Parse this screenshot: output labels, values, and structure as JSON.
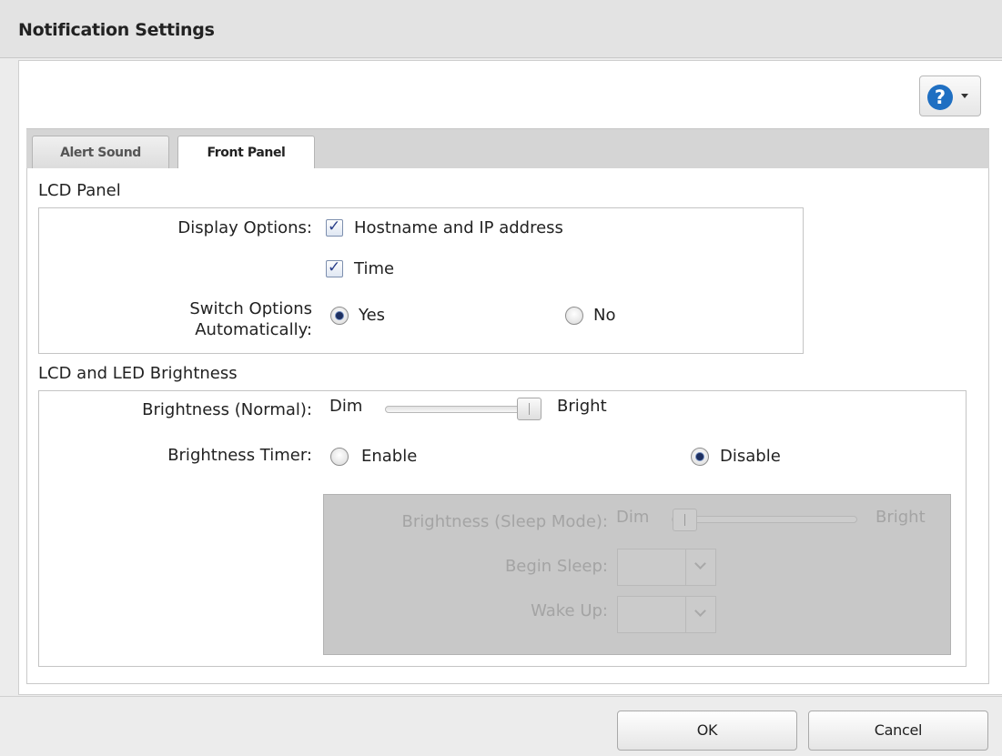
{
  "window": {
    "title": "Notification Settings"
  },
  "help": {
    "icon": "help-question-icon",
    "glyph": "?"
  },
  "tabs": [
    {
      "label": "Alert Sound",
      "active": false
    },
    {
      "label": "Front Panel",
      "active": true
    }
  ],
  "lcd_panel": {
    "title": "LCD Panel",
    "display_options_label": "Display Options:",
    "options": [
      {
        "label": "Hostname and IP address",
        "checked": true
      },
      {
        "label": "Time",
        "checked": true
      }
    ],
    "switch_label_line1": "Switch Options",
    "switch_label_line2": "Automatically:",
    "switch_yes": "Yes",
    "switch_no": "No",
    "switch_value": "Yes"
  },
  "brightness": {
    "title": "LCD and LED Brightness",
    "normal_label": "Brightness (Normal):",
    "dim": "Dim",
    "bright": "Bright",
    "normal_level": 1.0,
    "timer_label": "Brightness Timer:",
    "timer_enable": "Enable",
    "timer_disable": "Disable",
    "timer_value": "Disable",
    "sleep": {
      "label": "Brightness (Sleep Mode):",
      "dim": "Dim",
      "bright": "Bright",
      "level": 0.0,
      "begin_label": "Begin Sleep:",
      "begin_value": "",
      "wake_label": "Wake Up:",
      "wake_value": ""
    }
  },
  "footer": {
    "ok": "OK",
    "cancel": "Cancel"
  },
  "colors": {
    "help_blue": "#1f6fc2",
    "disabled_bg": "#c8c8c8"
  }
}
